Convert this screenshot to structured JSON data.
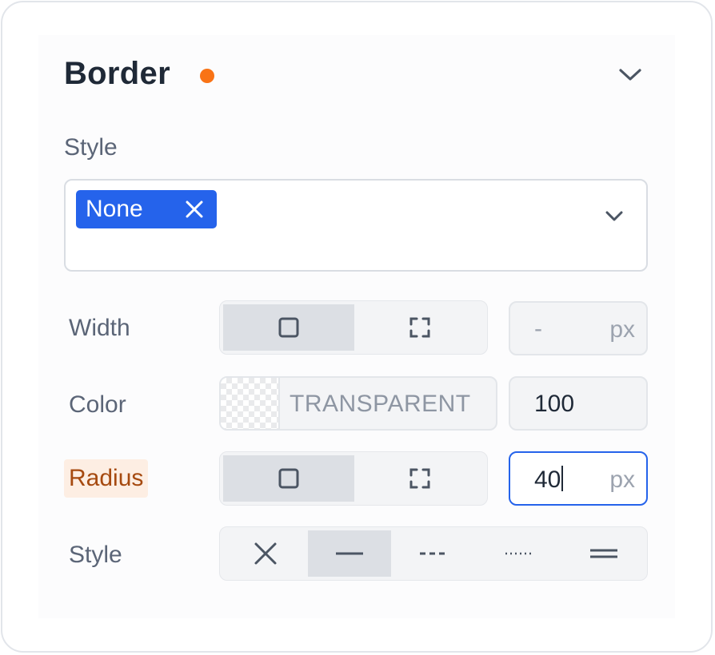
{
  "header": {
    "title": "Border",
    "dot_color": "#f97316"
  },
  "style_select": {
    "label": "Style",
    "selected_chip": "None"
  },
  "width": {
    "label": "Width",
    "value": "-",
    "unit": "px",
    "modes": [
      "all-sides-icon",
      "individual-sides-icon"
    ],
    "active_mode": "all-sides"
  },
  "color": {
    "label": "Color",
    "value": "TRANSPARENT",
    "opacity": "100"
  },
  "radius": {
    "label": "Radius",
    "value": "40",
    "unit": "px",
    "modes": [
      "all-corners-icon",
      "individual-corners-icon"
    ],
    "active_mode": "all-corners"
  },
  "border_style": {
    "label": "Style",
    "options": [
      "none",
      "solid",
      "dashed",
      "dotted",
      "double"
    ],
    "selected": "solid"
  },
  "colors": {
    "accent": "#2563eb",
    "highlight_bg": "#fdeee3",
    "highlight_text": "#a64a10"
  }
}
